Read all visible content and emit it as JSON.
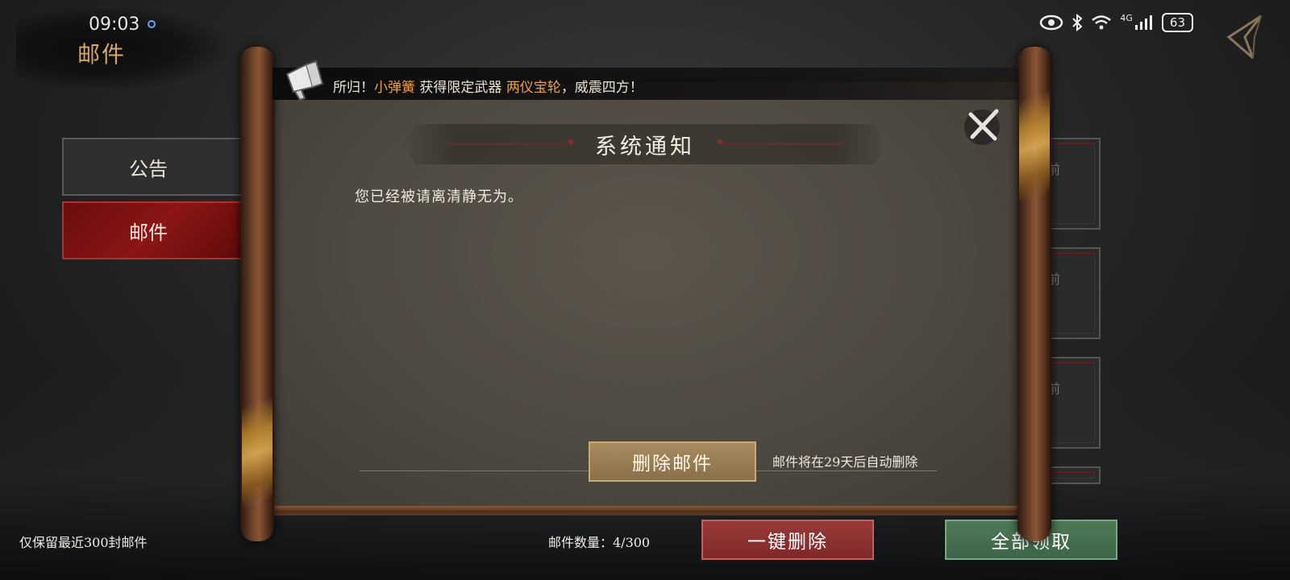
{
  "status_bar": {
    "time": "09:03",
    "battery": "63",
    "network": "4G"
  },
  "header": {
    "title": "邮件"
  },
  "tabs": [
    {
      "label": "公告"
    },
    {
      "label": "邮件"
    }
  ],
  "background_cards": [
    {
      "label": "前"
    },
    {
      "label": "前"
    },
    {
      "label": "前"
    }
  ],
  "announcement": {
    "prefix": "所归！",
    "player": "小弹簧",
    "middle": " 获得限定武器 ",
    "item": "两仪宝轮",
    "suffix": "，威震四方！"
  },
  "dialog": {
    "title": "系统通知",
    "body": "您已经被请离清静无为。",
    "delete_label": "删除邮件",
    "expire_note": "邮件将在29天后自动删除"
  },
  "footer": {
    "retention_note": "仅保留最近300封邮件",
    "count_label": "邮件数量：4/300",
    "delete_all_label": "一键删除",
    "claim_all_label": "全部领取"
  },
  "colors": {
    "accent_gold": "#d4a76a",
    "highlight_orange": "#e8a04a",
    "active_tab_red": "#8c1515",
    "claim_green": "#3d6547"
  }
}
